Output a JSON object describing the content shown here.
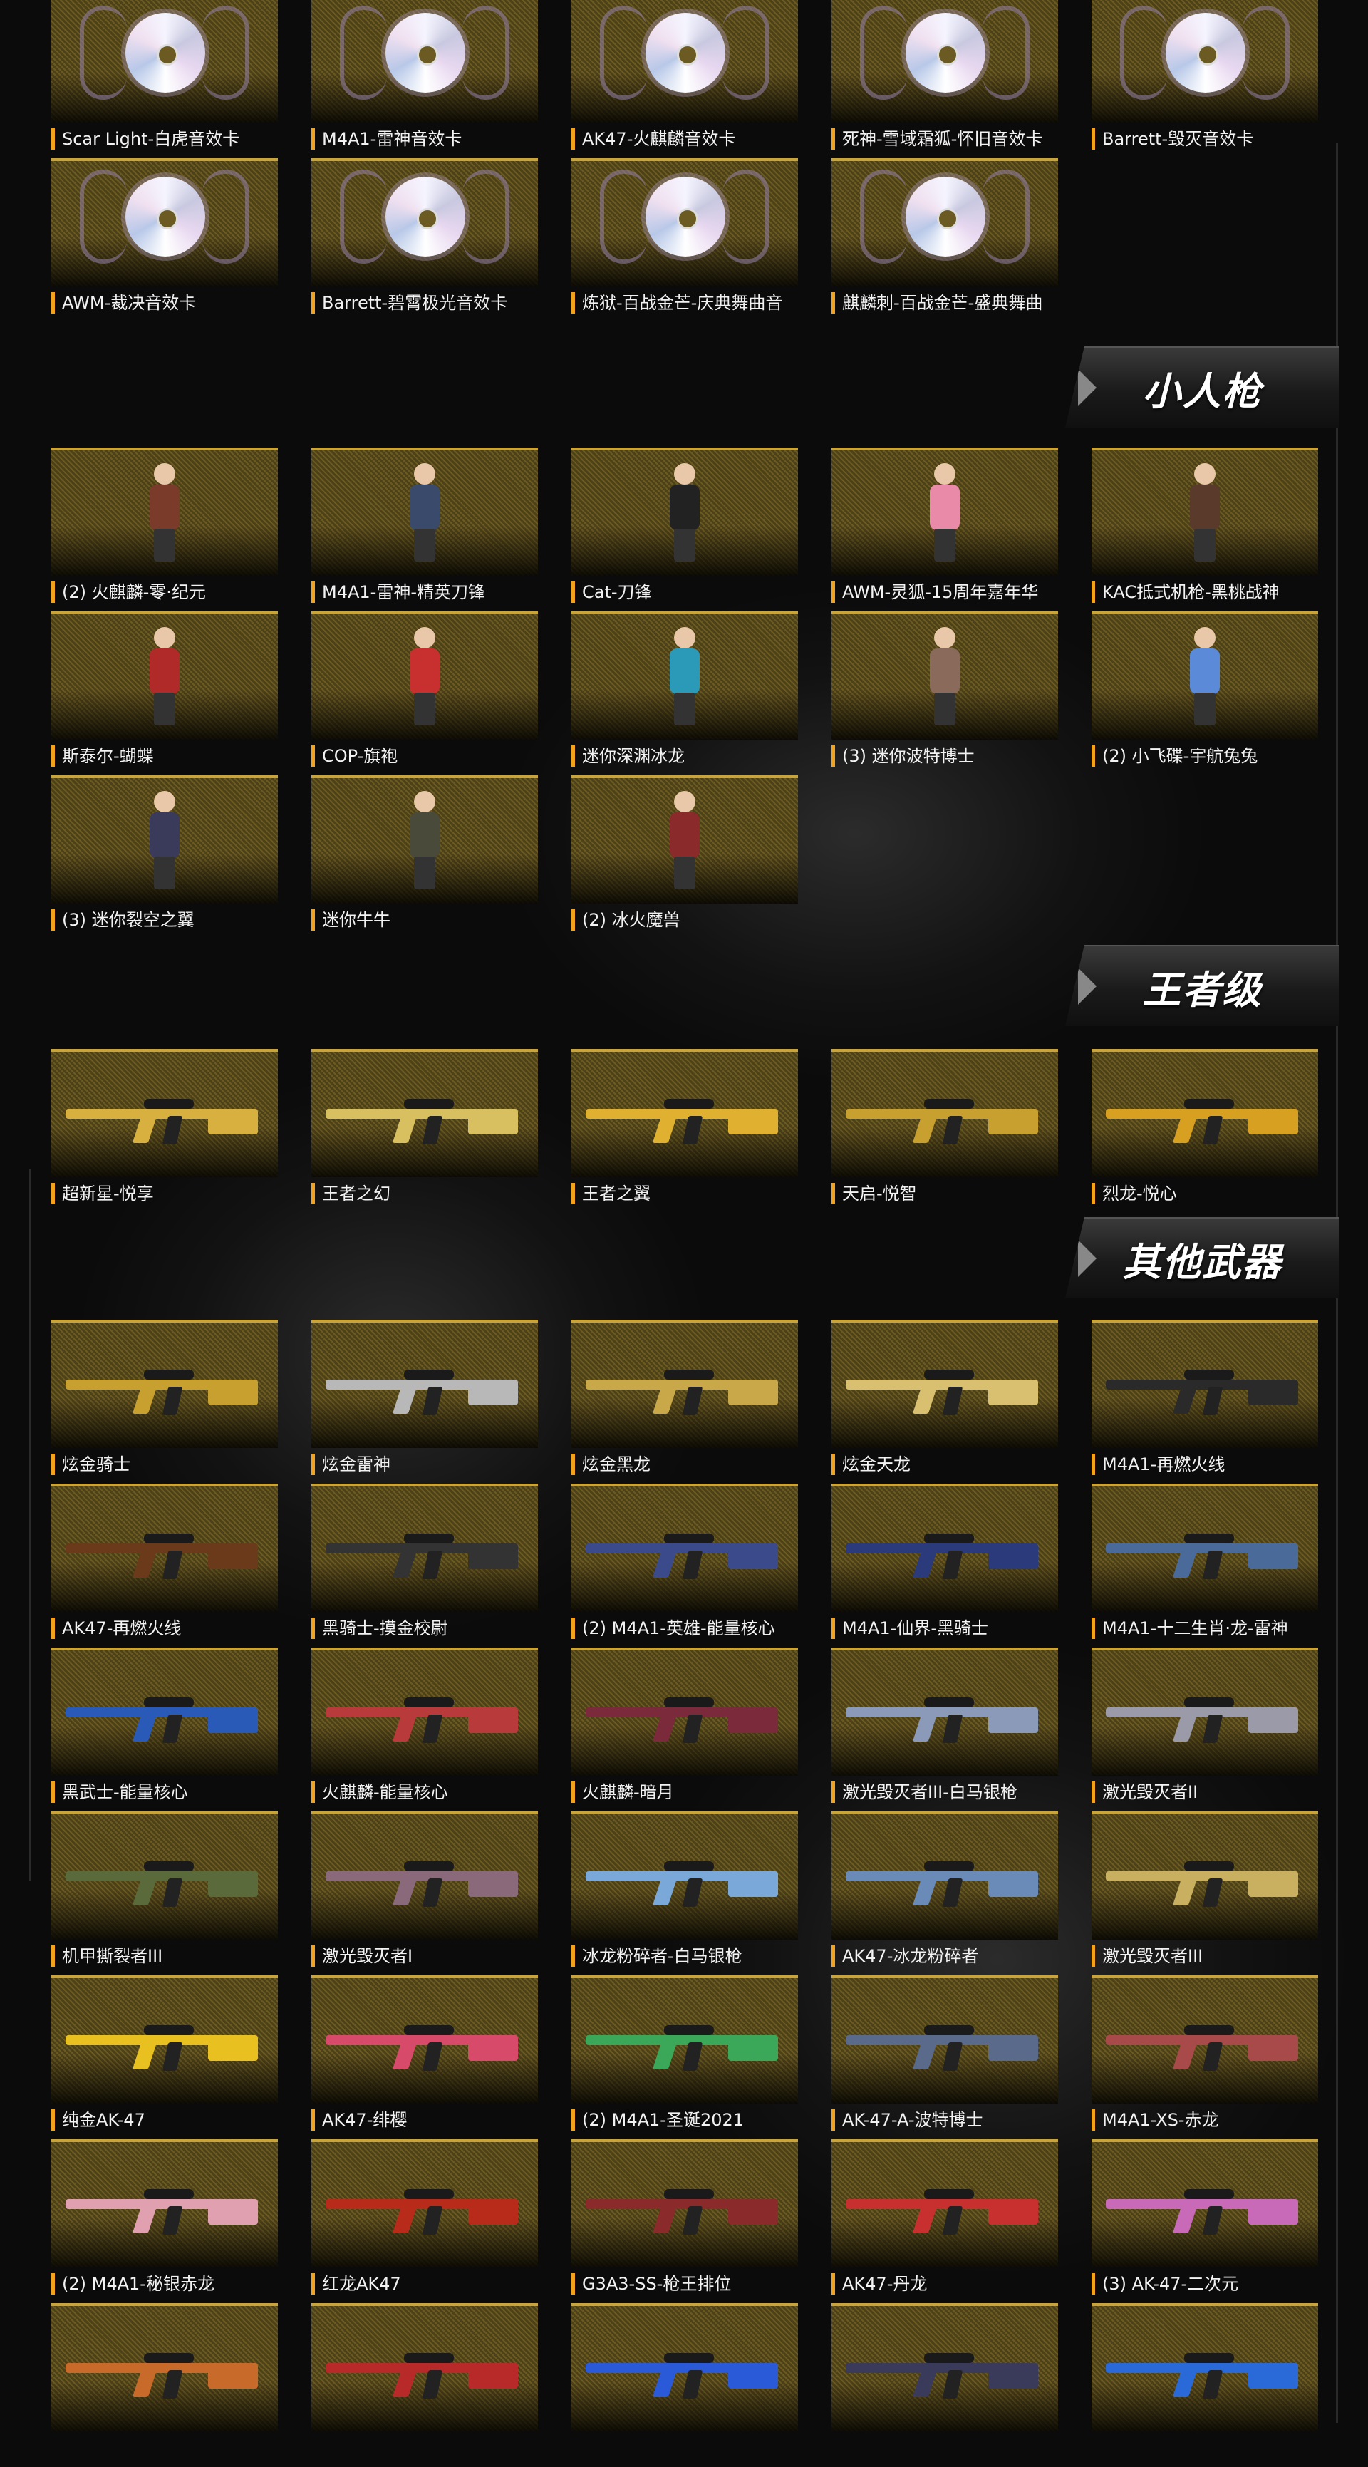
{
  "sections": {
    "music_cards": {
      "items": [
        {
          "label": "Scar Light-白虎音效卡"
        },
        {
          "label": "M4A1-雷神音效卡"
        },
        {
          "label": "AK47-火麒麟音效卡"
        },
        {
          "label": "死神-雪域霜狐-怀旧音效卡"
        },
        {
          "label": "Barrett-毁灭音效卡"
        },
        {
          "label": "AWM-裁决音效卡"
        },
        {
          "label": "Barrett-碧霄极光音效卡"
        },
        {
          "label": "炼狱-百战金芒-庆典舞曲音"
        },
        {
          "label": "麒麟刺-百战金芒-盛典舞曲"
        }
      ]
    },
    "mini_figures": {
      "title": "小人枪",
      "items": [
        {
          "label": "(2) 火麒麟-零·纪元",
          "color": "#7a3b2a"
        },
        {
          "label": "M4A1-雷神-精英刀锋",
          "color": "#3a4a6a"
        },
        {
          "label": "Cat-刀锋",
          "color": "#222222"
        },
        {
          "label": "AWM-灵狐-15周年嘉年华",
          "color": "#e88aa8"
        },
        {
          "label": "KAC抵式机枪-黑桃战神",
          "color": "#5a3a2a"
        },
        {
          "label": "斯泰尔-蝴蝶",
          "color": "#b02a2a"
        },
        {
          "label": "COP-旗袍",
          "color": "#c83030"
        },
        {
          "label": "迷你深渊冰龙",
          "color": "#2a9ab8"
        },
        {
          "label": "(3) 迷你波特博士",
          "color": "#8a6a5a"
        },
        {
          "label": "(2) 小飞碟-宇航兔兔",
          "color": "#5a8ad8"
        },
        {
          "label": "(3) 迷你裂空之翼",
          "color": "#3a3a5a"
        },
        {
          "label": "迷你牛牛",
          "color": "#4a4a3a"
        },
        {
          "label": "(2) 冰火魔兽",
          "color": "#8a2a2a"
        }
      ]
    },
    "king_tier": {
      "title": "王者级",
      "items": [
        {
          "label": "超新星-悦享",
          "color": "#d8b040"
        },
        {
          "label": "王者之幻",
          "color": "#d8c060"
        },
        {
          "label": "王者之翼",
          "color": "#e0b030"
        },
        {
          "label": "天启-悦智",
          "color": "#c8a030"
        },
        {
          "label": "烈龙-悦心",
          "color": "#d8a020"
        }
      ]
    },
    "other_weapons": {
      "title": "其他武器",
      "items": [
        {
          "label": "炫金骑士",
          "color": "#c8a030"
        },
        {
          "label": "炫金雷神",
          "color": "#b8b8b8"
        },
        {
          "label": "炫金黑龙",
          "color": "#c8a848"
        },
        {
          "label": "炫金天龙",
          "color": "#d8c070"
        },
        {
          "label": "M4A1-再燃火线",
          "color": "#2a2a2a"
        },
        {
          "label": "AK47-再燃火线",
          "color": "#6a3a1a"
        },
        {
          "label": "黑骑士-摸金校尉",
          "color": "#333333"
        },
        {
          "label": "(2) M4A1-英雄-能量核心",
          "color": "#3a4a8a"
        },
        {
          "label": "M4A1-仙界-黑骑士",
          "color": "#2a3a7a"
        },
        {
          "label": "M4A1-十二生肖·龙-雷神",
          "color": "#4a6a9a"
        },
        {
          "label": "黑武士-能量核心",
          "color": "#2a5ab8"
        },
        {
          "label": "火麒麟-能量核心",
          "color": "#b83a3a"
        },
        {
          "label": "火麒麟-暗月",
          "color": "#7a2a3a"
        },
        {
          "label": "激光毁灭者III-白马银枪",
          "color": "#8a9ab8"
        },
        {
          "label": "激光毁灭者II",
          "color": "#9a9aa8"
        },
        {
          "label": "机甲撕裂者III",
          "color": "#5a6a3a"
        },
        {
          "label": "激光毁灭者I",
          "color": "#8a6a7a"
        },
        {
          "label": "冰龙粉碎者-白马银枪",
          "color": "#7aa8d8"
        },
        {
          "label": "AK47-冰龙粉碎者",
          "color": "#6a8ab8"
        },
        {
          "label": "激光毁灭者III",
          "color": "#c8b060"
        },
        {
          "label": "纯金AK-47",
          "color": "#e8c020"
        },
        {
          "label": "AK47-绯樱",
          "color": "#d84a6a"
        },
        {
          "label": "(2) M4A1-圣诞2021",
          "color": "#3aa858"
        },
        {
          "label": "AK-47-A-波特博士",
          "color": "#5a6a8a"
        },
        {
          "label": "M4A1-XS-赤龙",
          "color": "#a84a4a"
        },
        {
          "label": "(2) M4A1-秘银赤龙",
          "color": "#e0a0b0"
        },
        {
          "label": "红龙AK47",
          "color": "#b82a1a"
        },
        {
          "label": "G3A3-SS-枪王排位",
          "color": "#8a2a2a"
        },
        {
          "label": "AK47-丹龙",
          "color": "#c83030"
        },
        {
          "label": "(3) AK-47-二次元",
          "color": "#c86ab8"
        },
        {
          "label": "",
          "color": "#c86a2a"
        },
        {
          "label": "",
          "color": "#b82a2a"
        },
        {
          "label": "",
          "color": "#2a5ad8"
        },
        {
          "label": "",
          "color": "#3a3a5a"
        },
        {
          "label": "",
          "color": "#2a6ad8"
        }
      ]
    }
  }
}
